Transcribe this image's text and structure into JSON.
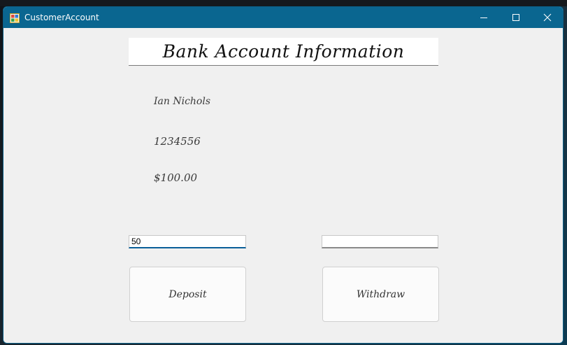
{
  "window": {
    "title": "CustomerAccount",
    "icon": "app-form-icon",
    "controls": [
      "minimize-icon",
      "maximize-icon",
      "close-icon"
    ]
  },
  "form": {
    "heading": "Bank Account Information",
    "customer_name": "Ian Nichols",
    "account_number": "1234556",
    "balance": "$100.00",
    "deposit_input": {
      "value": "50",
      "placeholder": ""
    },
    "withdraw_input": {
      "value": "",
      "placeholder": ""
    },
    "deposit_button_label": "Deposit",
    "withdraw_button_label": "Withdraw"
  },
  "colors": {
    "titlebar": "#0a6690",
    "client_background": "#f0f0f0",
    "focused_input_underline": "#0a5f99"
  }
}
